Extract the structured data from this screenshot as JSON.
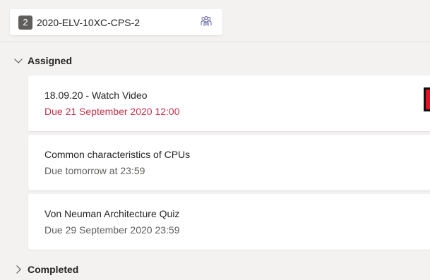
{
  "header": {
    "class_number": "2",
    "class_name": "2020-ELV-10XC-CPS-2",
    "team_icon": "team-icon"
  },
  "sections": {
    "assigned": {
      "label": "Assigned",
      "icon": "chevron-down-icon"
    },
    "completed": {
      "label": "Completed",
      "icon": "chevron-right-icon"
    }
  },
  "assignments": [
    {
      "title": "18.09.20 - Watch Video",
      "due": "Due 21 September 2020 12:00",
      "due_color": "#c4314b"
    },
    {
      "title": "Common characteristics of CPUs",
      "due": "Due tomorrow at 23:59",
      "due_color": "#605e5c"
    },
    {
      "title": "Von Neuman Architecture Quiz",
      "due": "Due 29 September 2020 23:59",
      "due_color": "#605e5c"
    }
  ],
  "colors": {
    "background": "#f3f2f1",
    "card": "#ffffff",
    "overdue": "#c4314b",
    "flag": "#e81123"
  }
}
